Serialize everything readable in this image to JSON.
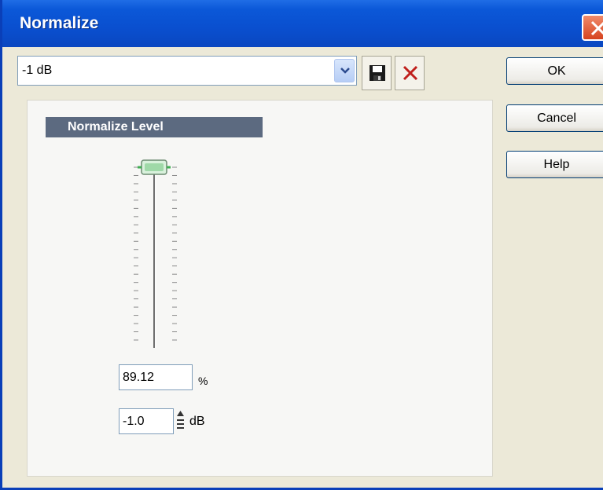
{
  "window": {
    "title": "Normalize",
    "close_icon": "close-icon"
  },
  "preset": {
    "value": "-1 dB",
    "dropdown_icon": "chevron-down-icon",
    "save_icon": "floppy-disk-icon",
    "delete_icon": "red-x-delete-icon"
  },
  "buttons": {
    "ok": "OK",
    "cancel": "Cancel",
    "help": "Help"
  },
  "normalize": {
    "group_title": "Normalize Level",
    "slider_level_percent": 100,
    "percent_value": "89.12",
    "percent_unit": "%",
    "db_value": "-1.0",
    "db_unit": "dB"
  },
  "colors": {
    "titlebar": "#0a4fcf",
    "group_header": "#5c6a80",
    "delete_x": "#c0201c",
    "thumb_green": "#3fae52"
  }
}
